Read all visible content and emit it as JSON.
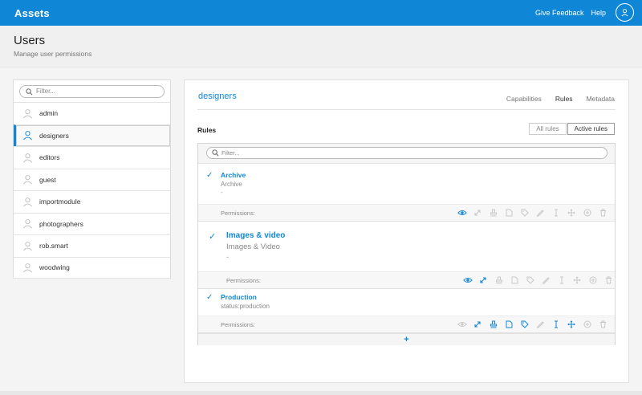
{
  "app": {
    "brand": "Assets",
    "links": [
      "Give Feedback",
      "Help"
    ]
  },
  "page": {
    "title": "Users",
    "subtitle": "Manage user permissions"
  },
  "user_filter": {
    "placeholder": "Filter..."
  },
  "users": [
    "admin",
    "designers",
    "editors",
    "guest",
    "importmodule",
    "photographers",
    "rob.smart",
    "woodwing"
  ],
  "selected_user": "designers",
  "detail": {
    "name": "designers",
    "tabs": [
      "Capabilities",
      "Rules",
      "Metadata"
    ],
    "active_tab": "Rules",
    "section_label": "Rules",
    "toggle": [
      "All rules",
      "Active rules"
    ],
    "active_toggle": "Active rules",
    "rule_filter_placeholder": "Filter...",
    "permissions_label": "Permissions:",
    "add_symbol": "+",
    "rules": [
      {
        "name": "Archive",
        "description": "Archive",
        "dash": "-"
      },
      {
        "name": "Images & video",
        "description": "Images & Video",
        "dash": "-"
      },
      {
        "name": "Production",
        "description": "status:production"
      }
    ]
  },
  "permission_icons": [
    "eye-icon",
    "expand-icon",
    "stamp-icon",
    "document-icon",
    "tag-icon",
    "pencil-icon",
    "text-cursor-icon",
    "move-icon",
    "plus-circle-icon",
    "trash-icon"
  ],
  "colors": {
    "accent": "#0f87d6",
    "inactive": "#c8c8c8"
  }
}
